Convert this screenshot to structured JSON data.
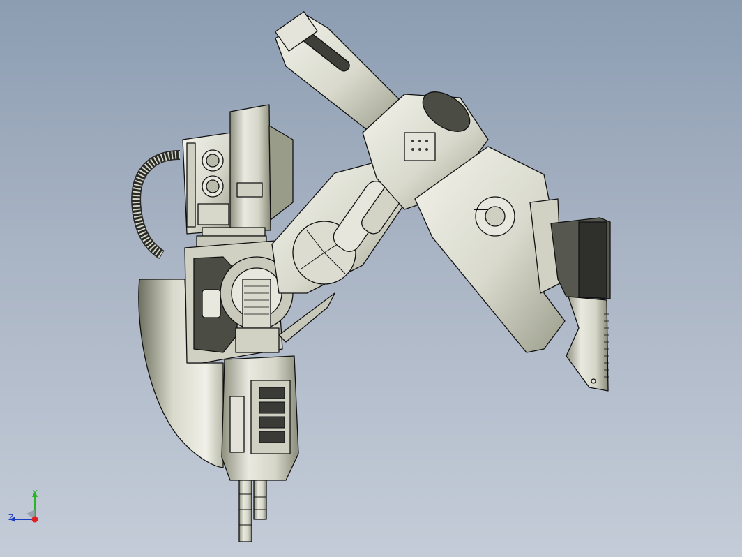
{
  "viewport": {
    "background_top": "#8c9db2",
    "background_bottom": "#c4ccd8",
    "model_fill": "#e4e4da",
    "model_shade": "#a9ab9b",
    "model_dark": "#3a3a36",
    "edge_color": "#111111"
  },
  "triad": {
    "y_label": "Y",
    "z_label": "Z",
    "y_color": "#2bb526",
    "z_color": "#1b3dbf",
    "x_color": "#e02020"
  },
  "icons": {
    "triad": "axis-triad-icon",
    "model": "robot-arm-model"
  }
}
